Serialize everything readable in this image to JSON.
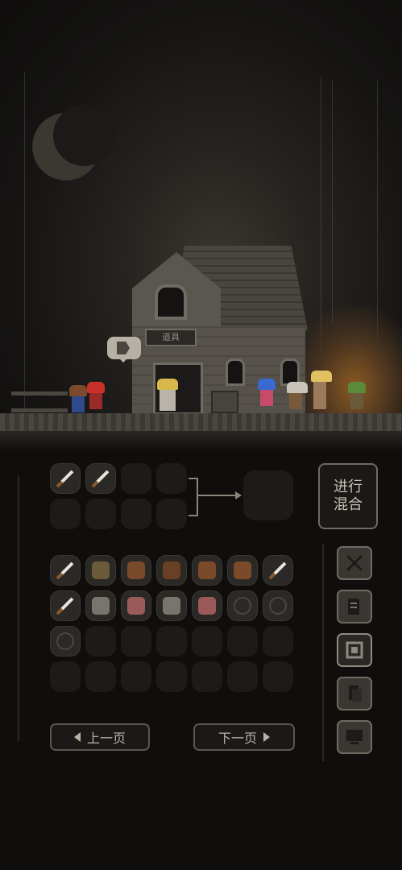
{
  "scene": {
    "shop_sign": "道具"
  },
  "mixing": {
    "input_slots": [
      "sword",
      "sword",
      "empty",
      "empty",
      "empty",
      "empty",
      "empty",
      "empty"
    ],
    "mix_button_label": "进行混合"
  },
  "inventory": {
    "rows": [
      [
        "sword",
        "witch-hat",
        "leather-armor",
        "boot",
        "log",
        "leather-pants",
        "sword"
      ],
      [
        "sword",
        "stone-tablet",
        "red-tablet",
        "stone-tablet",
        "red-tablet",
        "ring",
        "ring"
      ],
      [
        "ring",
        "empty",
        "empty",
        "empty",
        "empty",
        "empty",
        "empty"
      ],
      [
        "empty",
        "empty",
        "empty",
        "empty",
        "empty",
        "empty",
        "empty"
      ]
    ]
  },
  "pagination": {
    "prev_label": "上一页",
    "next_label": "下一页"
  },
  "tabs": [
    {
      "icon": "crossed-swords-icon",
      "active": false
    },
    {
      "icon": "scroll-icon",
      "active": false
    },
    {
      "icon": "mix-box-icon",
      "active": true
    },
    {
      "icon": "document-icon",
      "active": false
    },
    {
      "icon": "monitor-icon",
      "active": false
    }
  ],
  "colors": {
    "background": "#0f0e0d",
    "slot": "#1c1b19",
    "border": "#6f6a62"
  }
}
